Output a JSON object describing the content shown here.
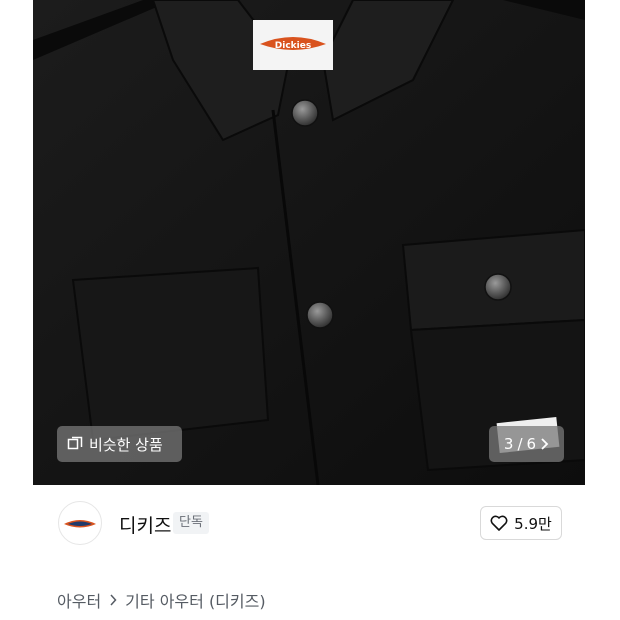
{
  "gallery": {
    "similar_label": "비슷한 상품",
    "pager_current": "3",
    "pager_separator": "/",
    "pager_total": "6",
    "icons": {
      "similar": "similar-products-icon",
      "next": "chevron-right-icon"
    }
  },
  "brand": {
    "name": "디키즈",
    "badge": "단독",
    "logo_text": "Dickies",
    "like_count": "5.9만",
    "icons": {
      "like": "heart-icon"
    }
  },
  "breadcrumb": {
    "items": [
      "아우터",
      "기타 아우터 (디키즈)"
    ]
  },
  "colors": {
    "photo_bg": "#121212",
    "overlay": "#787878",
    "badge_bg": "#f1f3f5",
    "text_primary": "#111111",
    "text_secondary": "#555b63"
  }
}
